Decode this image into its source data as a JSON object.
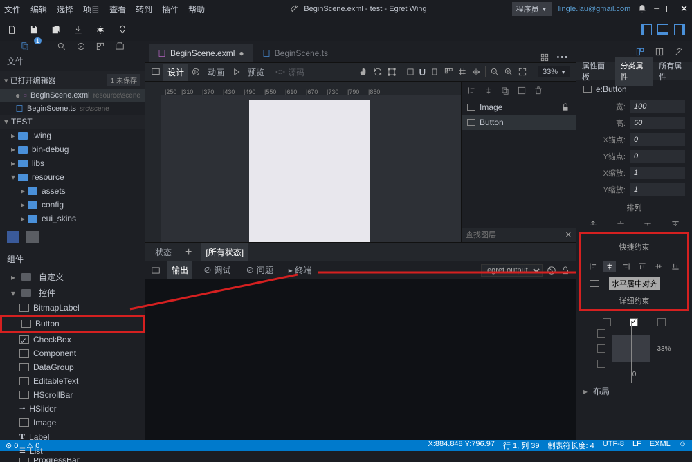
{
  "menubar": [
    "文件",
    "编辑",
    "选择",
    "项目",
    "查看",
    "转到",
    "插件",
    "帮助"
  ],
  "window_title": "BeginScene.exml - test - Egret Wing",
  "user_role": "程序员",
  "user_email": "lingle.lau@gmail.com",
  "files_header": "文件",
  "open_editors": {
    "label": "已打开编辑器",
    "badge": "1 未保存"
  },
  "open_files": [
    {
      "name": "BeginScene.exml",
      "path": "resource\\scene",
      "dirty": true
    },
    {
      "name": "BeginScene.ts",
      "path": "src\\scene"
    }
  ],
  "project": {
    "name": "TEST"
  },
  "tree": [
    {
      "name": ".wing",
      "depth": 1
    },
    {
      "name": "bin-debug",
      "depth": 1
    },
    {
      "name": "libs",
      "depth": 1
    },
    {
      "name": "resource",
      "depth": 1,
      "expanded": true
    },
    {
      "name": "assets",
      "depth": 2
    },
    {
      "name": "config",
      "depth": 2
    },
    {
      "name": "eui_skins",
      "depth": 2
    }
  ],
  "components_header": "组件",
  "comp_groups": [
    {
      "name": "自定义"
    },
    {
      "name": "控件",
      "expanded": true,
      "items": [
        "BitmapLabel",
        "Button",
        "CheckBox",
        "Component",
        "DataGroup",
        "EditableText",
        "HScrollBar",
        "HSlider",
        "Image",
        "Label",
        "List",
        "ProgressBar"
      ]
    }
  ],
  "tabs": [
    {
      "name": "BeginScene.exml",
      "active": true,
      "dirty": true
    },
    {
      "name": "BeginScene.ts",
      "active": false
    }
  ],
  "modes": [
    {
      "label": "设计",
      "active": true
    },
    {
      "label": "动画"
    },
    {
      "label": "预览"
    },
    {
      "label": "源码",
      "dim": true
    }
  ],
  "zoom": "33%",
  "ruler_ticks": [
    250,
    310,
    370,
    430,
    490,
    550,
    610,
    670,
    730,
    790,
    850
  ],
  "layers": [
    {
      "name": "Image",
      "locked": true
    },
    {
      "name": "Button",
      "active": true
    }
  ],
  "layer_search": "查找图层",
  "state_label": "状态",
  "all_states": "[所有状态]",
  "output_tabs": [
    "输出",
    "调试",
    "问题",
    "终端"
  ],
  "output_combo": "egret.output",
  "prop_panel_tabs": [
    "属性面板",
    "分类属性",
    "所有属性"
  ],
  "selection_type": "e:Button",
  "properties": [
    {
      "label": "宽:",
      "value": "100"
    },
    {
      "label": "高:",
      "value": "50"
    },
    {
      "label": "X锚点:",
      "value": "0"
    },
    {
      "label": "Y锚点:",
      "value": "0"
    },
    {
      "label": "X缩放:",
      "value": "1"
    },
    {
      "label": "Y缩放:",
      "value": "1"
    }
  ],
  "arrange_label": "排列",
  "quick_constraint_label": "快捷约束",
  "align_tooltip": "水平居中对齐",
  "detail_constraint_label": "详细约束",
  "constraint_value_right": "33%",
  "constraint_value_bottom": "0",
  "layout_label": "布局",
  "status": {
    "coords": "X:884.848 Y:796.97",
    "sel": "行 1, 列 39",
    "tab": "制表符长度: 4",
    "enc": "UTF-8",
    "eol": "LF",
    "lang": "EXML"
  }
}
